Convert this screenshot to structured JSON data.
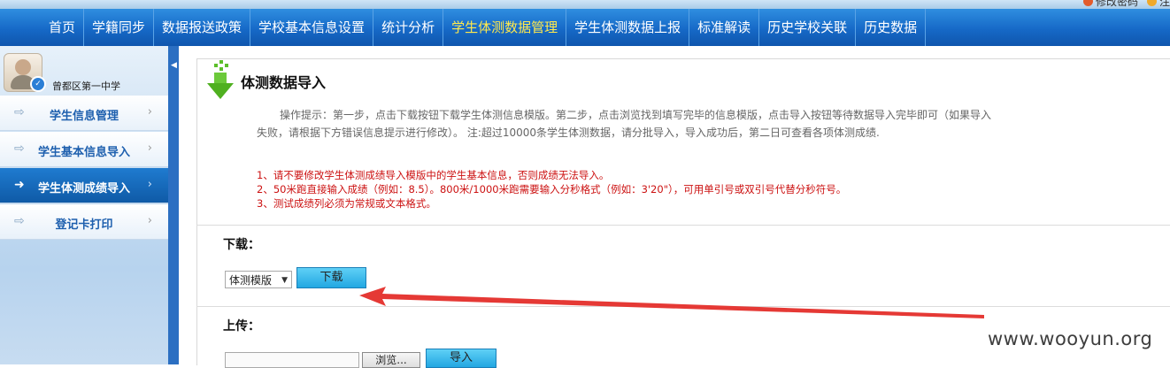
{
  "top_links": [
    {
      "label": "修改密码",
      "icon": "lock-icon"
    },
    {
      "label": "注",
      "icon": "logout-icon"
    }
  ],
  "nav": {
    "items": [
      {
        "label": "首页"
      },
      {
        "label": "学籍同步"
      },
      {
        "label": "数据报送政策"
      },
      {
        "label": "学校基本信息设置"
      },
      {
        "label": "统计分析"
      },
      {
        "label": "学生体测数据管理",
        "active": true
      },
      {
        "label": "学生体测数据上报"
      },
      {
        "label": "标准解读"
      },
      {
        "label": "历史学校关联"
      },
      {
        "label": "历史数据"
      }
    ],
    "active_color": "#ffe94d"
  },
  "user": {
    "school_name": "曾都区第一中学",
    "avatar_icon": "user-avatar-icon"
  },
  "sidebar": {
    "items": [
      {
        "label": "学生信息管理",
        "active": false
      },
      {
        "label": "学生基本信息导入",
        "active": false
      },
      {
        "label": "学生体测成绩导入",
        "active": true
      },
      {
        "label": "登记卡打印",
        "active": false
      }
    ],
    "arrow_icon": "right-arrow-icon",
    "chevron_icon": "chevron-right-icon"
  },
  "main": {
    "title": "体测数据导入",
    "title_icon": "download-arrow-icon",
    "tip": "操作提示：第一步，点击下载按钮下载学生体测信息模版。第二步，点击浏览找到填写完毕的信息模版，点击导入按钮等待数据导入完毕即可（如果导入失败，请根据下方错误信息提示进行修改）。 注:超过10000条学生体测数据，请分批导入，导入成功后，第二日可查看各项体测成绩.",
    "notes": [
      "1、请不要修改学生体测成绩导入模版中的学生基本信息，否则成绩无法导入。",
      "2、50米跑直接输入成绩（例如：8.5）。800米/1000米跑需要输入分秒格式（例如：3'20\"），可用单引号或双引号代替分秒符号。",
      "3、测试成绩列必须为常规或文本格式。"
    ],
    "download": {
      "label": "下载：",
      "select_value": "体测模版",
      "button": "下载"
    },
    "upload": {
      "label": "上传：",
      "file_value": "",
      "browse_button": "浏览...",
      "import_button": "导入"
    }
  },
  "watermark": "www.wooyun.org",
  "colors": {
    "nav_bg": "#1669c7",
    "note_red": "#cc1111",
    "button_blue": "#22a7e2",
    "annotation_arrow": "#e53935"
  }
}
